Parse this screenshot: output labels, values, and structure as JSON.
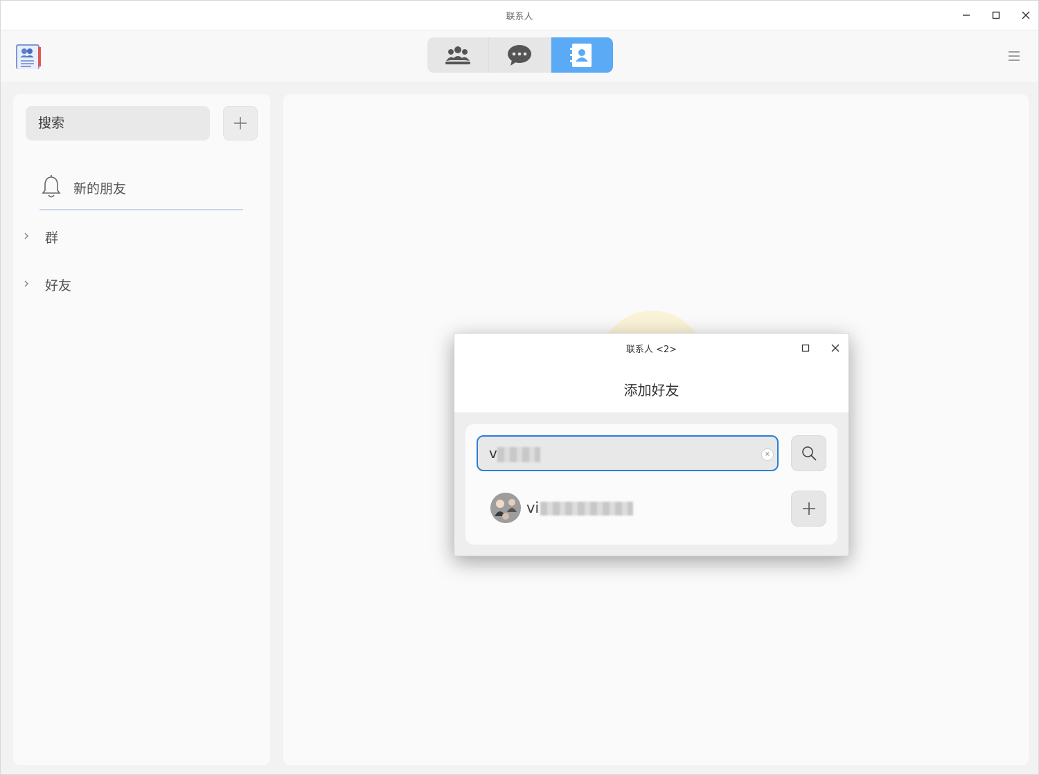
{
  "window": {
    "title": "联系人"
  },
  "toolbar": {
    "tabs": [
      {
        "icon": "group-icon",
        "active": false
      },
      {
        "icon": "chat-bubble-icon",
        "active": false
      },
      {
        "icon": "contact-card-icon",
        "active": true
      }
    ]
  },
  "sidebar": {
    "search_placeholder": "搜索",
    "new_friends_label": "新的朋友",
    "sections": [
      {
        "label": "群"
      },
      {
        "label": "好友"
      }
    ]
  },
  "dialog": {
    "title": "联系人 <2>",
    "heading": "添加好友",
    "search_value_prefix": "v",
    "result_name_prefix": "vi"
  },
  "colors": {
    "accent": "#5aaaf5",
    "focus_border": "#2a7fd4"
  }
}
